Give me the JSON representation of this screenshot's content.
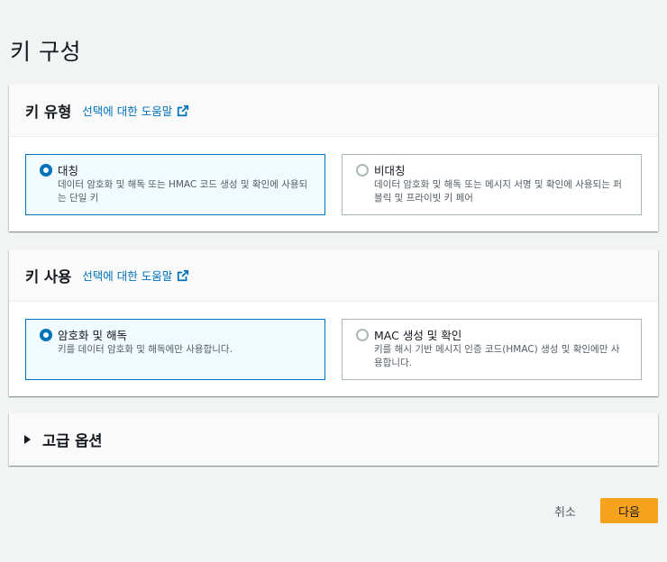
{
  "page": {
    "title": "키 구성"
  },
  "key_type": {
    "title": "키 유형",
    "help_link": "선택에 대한 도움말",
    "options": [
      {
        "label": "대칭",
        "description": "데이터 암호화 및 해독 또는 HMAC 코드 생성 및 확인에 사용되는 단일 키",
        "selected": true
      },
      {
        "label": "비대칭",
        "description": "데이터 암호화 및 해독 또는 메시지 서명 및 확인에 사용되는 퍼블릭 및 프라이빗 키 페어",
        "selected": false
      }
    ]
  },
  "key_usage": {
    "title": "키 사용",
    "help_link": "선택에 대한 도움말",
    "options": [
      {
        "label": "암호화 및 해독",
        "description": "키를 데이터 암호화 및 해독에만 사용합니다.",
        "selected": true
      },
      {
        "label": "MAC 생성 및 확인",
        "description": "키를 해시 기반 메시지 인증 코드(HMAC) 생성 및 확인에만 사용합니다.",
        "selected": false
      }
    ]
  },
  "advanced": {
    "title": "고급 옵션",
    "expanded": false
  },
  "footer": {
    "cancel_label": "취소",
    "next_label": "다음"
  },
  "colors": {
    "link": "#0073bb",
    "selected_border": "#0073bb",
    "selected_background": "#f1faff",
    "primary_button": "#f7a21c",
    "page_background": "#f2f3f3"
  }
}
